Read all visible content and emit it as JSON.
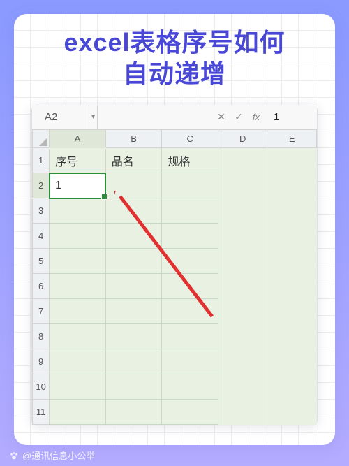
{
  "title_line1": "excel表格序号如何",
  "title_line2": "自动递增",
  "formulabar": {
    "namebox": "A2",
    "cancel_icon": "✕",
    "accept_icon": "✓",
    "fx_label": "fx",
    "value": "1"
  },
  "columns": [
    "A",
    "B",
    "C",
    "D",
    "E"
  ],
  "rows": [
    "1",
    "2",
    "3",
    "4",
    "5",
    "6",
    "7",
    "8",
    "9",
    "10",
    "11"
  ],
  "cells": {
    "A1": "序号",
    "B1": "品名",
    "C1": "规格",
    "A2": "1"
  },
  "selected_cell": "A2",
  "watermark": "@通讯信息小公举",
  "chart_data": {
    "type": "table",
    "title": "excel表格序号如何自动递增",
    "columns": [
      "A",
      "B",
      "C",
      "D",
      "E"
    ],
    "headers_row1": {
      "A": "序号",
      "B": "品名",
      "C": "规格"
    },
    "data": {
      "A2": 1
    },
    "selected": "A2",
    "formula_bar": {
      "ref": "A2",
      "value": "1"
    }
  }
}
